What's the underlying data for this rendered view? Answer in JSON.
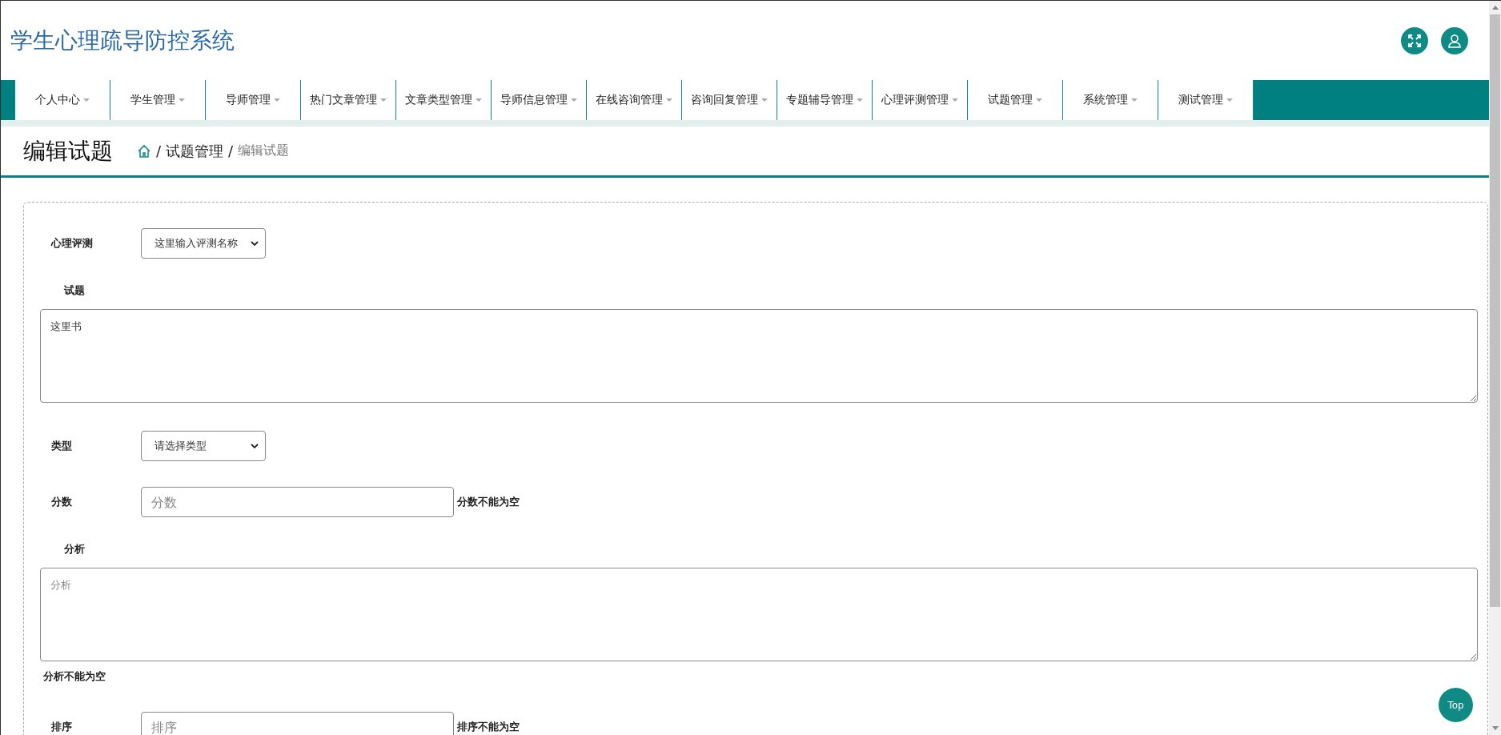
{
  "header": {
    "title": "学生心理疏导防控系统"
  },
  "nav": {
    "items": [
      {
        "label": "个人中心"
      },
      {
        "label": "学生管理"
      },
      {
        "label": "导师管理"
      },
      {
        "label": "热门文章管理"
      },
      {
        "label": "文章类型管理"
      },
      {
        "label": "导师信息管理"
      },
      {
        "label": "在线咨询管理"
      },
      {
        "label": "咨询回复管理"
      },
      {
        "label": "专题辅导管理"
      },
      {
        "label": "心理评测管理"
      },
      {
        "label": "试题管理"
      },
      {
        "label": "系统管理"
      },
      {
        "label": "测试管理"
      }
    ]
  },
  "page": {
    "title": "编辑试题",
    "breadcrumb": [
      {
        "separator": "/",
        "label": "试题管理",
        "current": false
      },
      {
        "separator": "/",
        "label": "编辑试题",
        "current": true
      }
    ]
  },
  "form": {
    "fields": [
      {
        "kind": "select",
        "label": "心理评测",
        "value": "这里输入评测名称"
      },
      {
        "kind": "textarea",
        "label": "试题",
        "value": "这里书"
      },
      {
        "kind": "select",
        "label": "类型",
        "value": "请选择类型"
      },
      {
        "kind": "input",
        "label": "分数",
        "placeholder": "分数",
        "error": "分数不能为空"
      },
      {
        "kind": "textarea",
        "label": "分析",
        "placeholder": "分析",
        "error": "分析不能为空"
      },
      {
        "kind": "input",
        "label": "排序",
        "placeholder": "排序",
        "error": "排序不能为空"
      }
    ]
  },
  "back_to_top": {
    "label": "Top"
  }
}
